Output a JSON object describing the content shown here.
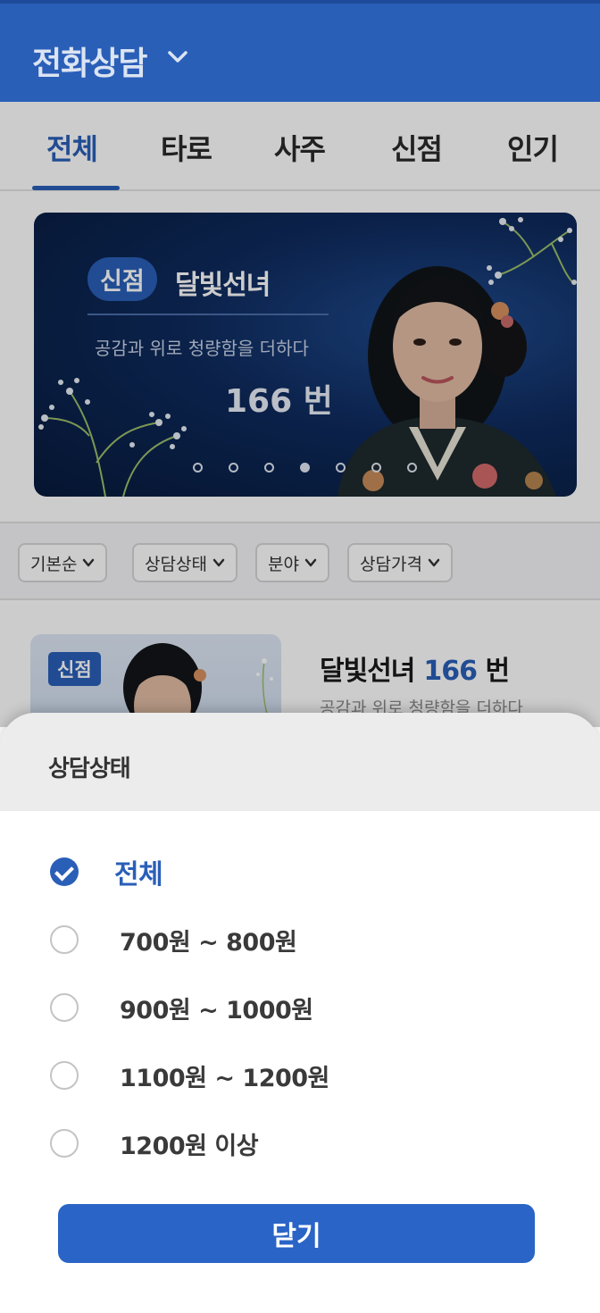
{
  "header": {
    "title": "전화상담"
  },
  "tabs": [
    {
      "label": "전체"
    },
    {
      "label": "타로"
    },
    {
      "label": "사주"
    },
    {
      "label": "신점"
    },
    {
      "label": "인기"
    }
  ],
  "banner": {
    "badge": "신점",
    "name": "달빛선녀",
    "subtitle": "공감과 위로 청량함을 더하다",
    "number": "166 번",
    "dots_total": 7,
    "active_dot": 4
  },
  "filters": [
    {
      "label": "기본순"
    },
    {
      "label": "상담상태"
    },
    {
      "label": "분야"
    },
    {
      "label": "상담가격"
    }
  ],
  "list_item": {
    "badge": "신점",
    "name": "달빛선녀",
    "number": "166",
    "number_unit": "번",
    "subtitle": "공감과 위로 청량함을 더하다"
  },
  "sheet": {
    "title": "상담상태",
    "options": [
      {
        "label": "전체",
        "selected": true
      },
      {
        "label": "700원 ~ 800원",
        "selected": false
      },
      {
        "label": "900원 ~ 1000원",
        "selected": false
      },
      {
        "label": "1100원 ~ 1200원",
        "selected": false
      },
      {
        "label": "1200원 이상",
        "selected": false
      }
    ],
    "close_label": "닫기"
  },
  "colors": {
    "primary": "#2a5fb8",
    "header_bg": "#2a5fb8",
    "banner_bg": "#0e2a5c"
  }
}
